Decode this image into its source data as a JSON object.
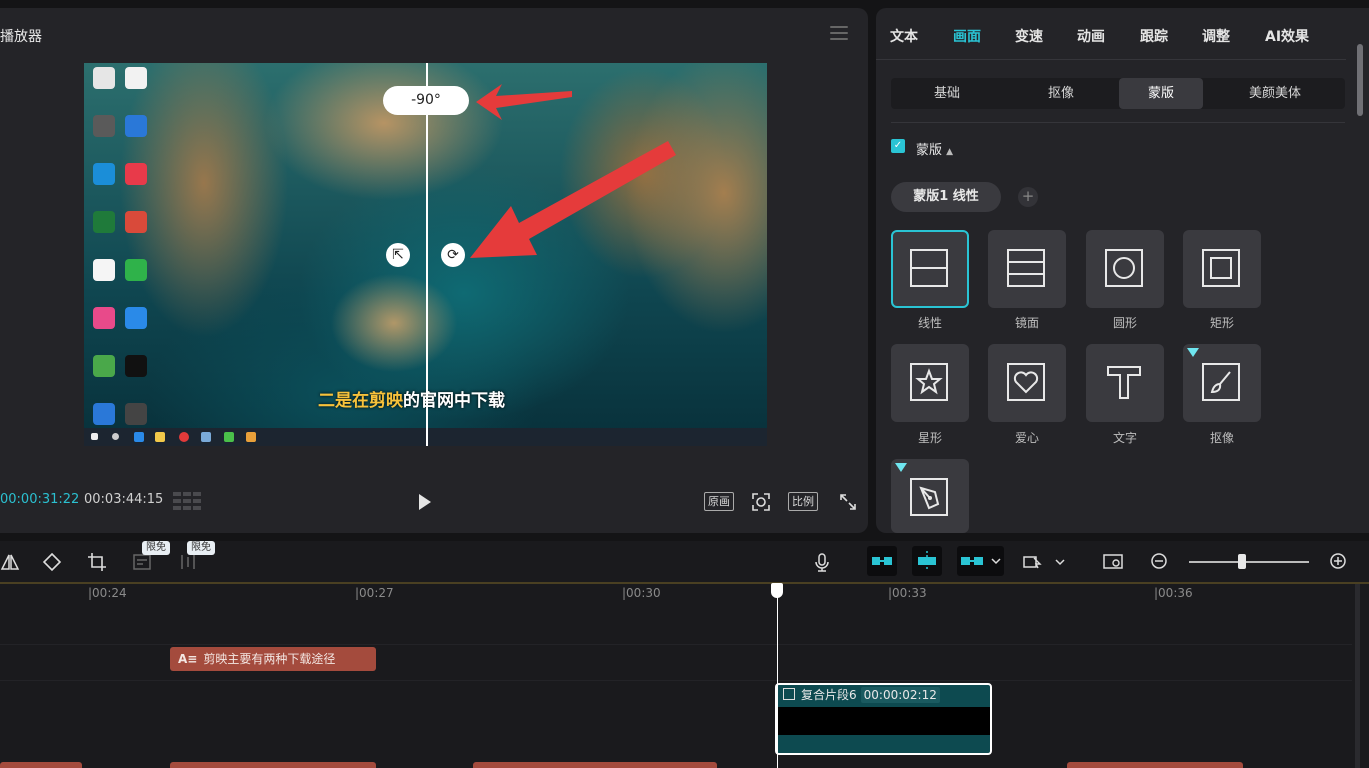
{
  "player": {
    "title": "播放器",
    "menu_icon": "hamburger-icon",
    "current_time": "00:00:31:22",
    "total_time": "00:03:44:15",
    "buttons": [
      "原画",
      "比例"
    ],
    "video": {
      "angle": "-90°",
      "subtitle_highlight": "二是在剪映",
      "subtitle_rest": "的官网中下载"
    }
  },
  "panel": {
    "tabs": [
      {
        "label": "文本",
        "active": false
      },
      {
        "label": "画面",
        "active": true
      },
      {
        "label": "变速",
        "active": false
      },
      {
        "label": "动画",
        "active": false
      },
      {
        "label": "跟踪",
        "active": false
      },
      {
        "label": "调整",
        "active": false
      },
      {
        "label": "AI效果",
        "active": false
      }
    ],
    "subtabs": [
      {
        "label": "基础",
        "active": false
      },
      {
        "label": "抠像",
        "active": false
      },
      {
        "label": "蒙版",
        "active": true
      },
      {
        "label": "美颜美体",
        "active": false
      }
    ],
    "mask_section": "蒙版",
    "mask_pill": "蒙版1 线性",
    "mask_types": [
      "线性",
      "镜面",
      "圆形",
      "矩形",
      "星形",
      "爱心",
      "文字",
      "抠像"
    ],
    "accent_color": "#2ac4d4"
  },
  "timeline": {
    "badges": [
      "限免",
      "限免"
    ],
    "ruler": [
      "00:24",
      "00:27",
      "00:30",
      "00:33",
      "00:36"
    ],
    "text_clip": "剪映主要有两种下载途径",
    "compound_clip": {
      "name": "复合片段6",
      "duration": "00:00:02:12"
    },
    "clip_color": "#a44b3d"
  }
}
